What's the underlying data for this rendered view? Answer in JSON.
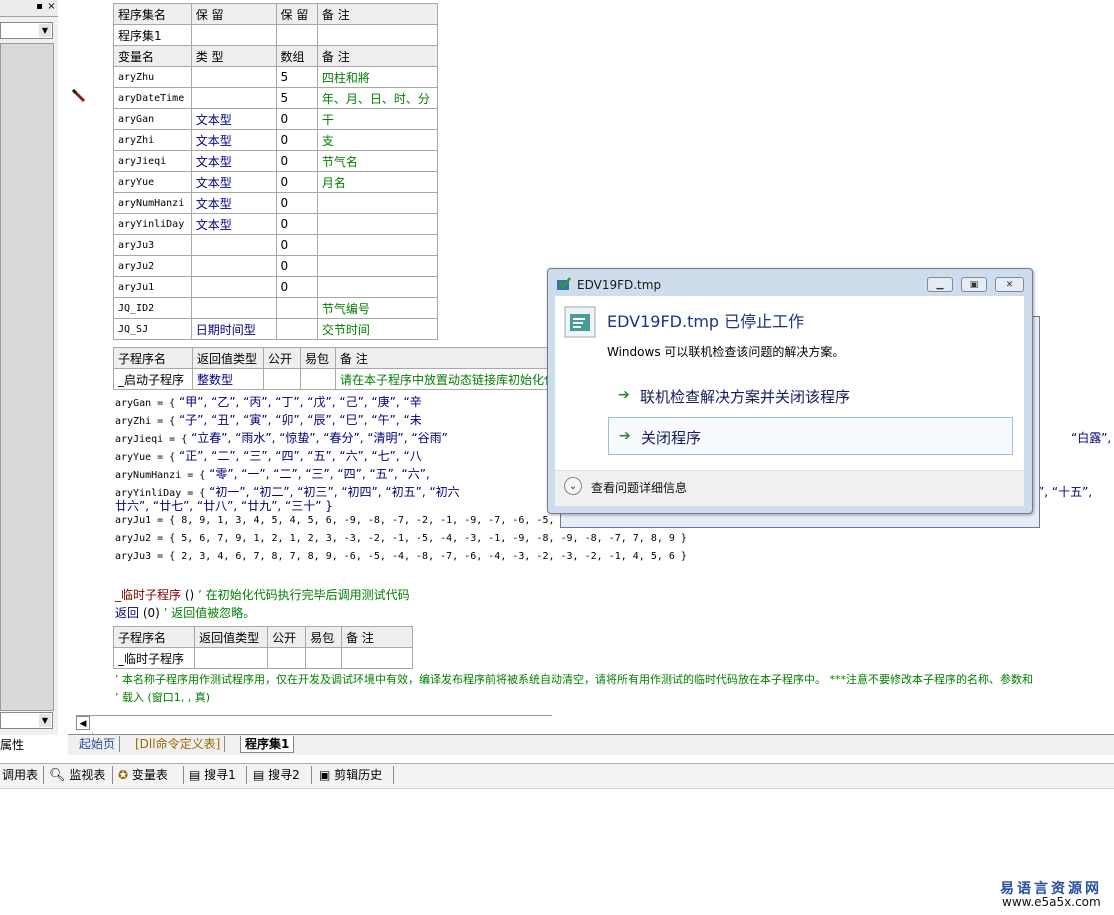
{
  "left_panel": {
    "minimize_glyph": "▪",
    "close_glyph": "×",
    "props_tab": "属性"
  },
  "table1": {
    "header": [
      "程序集名",
      "保 留",
      "保 留",
      "备 注"
    ],
    "row": [
      "程序集1",
      "",
      "",
      ""
    ]
  },
  "table2": {
    "header": [
      "变量名",
      "类 型",
      "数组",
      "备 注"
    ],
    "rows": [
      [
        "aryZhu",
        "",
        "5",
        "四柱和將"
      ],
      [
        "aryDateTime",
        "",
        "5",
        "年、月、日、时、分"
      ],
      [
        "aryGan",
        "文本型",
        "0",
        "干"
      ],
      [
        "aryZhi",
        "文本型",
        "0",
        "支"
      ],
      [
        "aryJieqi",
        "文本型",
        "0",
        "节气名"
      ],
      [
        "aryYue",
        "文本型",
        "0",
        "月名"
      ],
      [
        "aryNumHanzi",
        "文本型",
        "0",
        ""
      ],
      [
        "aryYinliDay",
        "文本型",
        "0",
        ""
      ],
      [
        "aryJu3",
        "",
        "0",
        ""
      ],
      [
        "aryJu2",
        "",
        "0",
        ""
      ],
      [
        "aryJu1",
        "",
        "0",
        ""
      ],
      [
        "JQ_ID2",
        "",
        "",
        "节气编号"
      ],
      [
        "JQ_SJ",
        "日期时间型",
        "",
        "交节时间"
      ]
    ]
  },
  "table3": {
    "header": [
      "子程序名",
      "返回值类型",
      "公开",
      "易包",
      "备 注"
    ],
    "row": [
      "_启动子程序",
      "整数型",
      "",
      "",
      "请在本子程序中放置动态链接库初始化代码"
    ]
  },
  "code": {
    "gan": {
      "lhs": "aryGan = {",
      "vals": "“甲”, “乙”, “丙”, “丁”, “戊”, “己”, “庚”, “辛"
    },
    "zhi": {
      "lhs": "aryZhi = {",
      "vals": "“子”, “丑”, “寅”, “卯”, “辰”, “巳”, “午”, “未"
    },
    "jieqi": {
      "lhs": "aryJieqi = {",
      "vals": "“立春”, “雨水”, “惊蛰”, “春分”, “清明”, “谷雨”",
      "tail": "“白露”, “秋"
    },
    "yue": {
      "lhs": "aryYue = {",
      "vals": "“正”, “二”, “三”, “四”, “五”, “六”, “七”, “八"
    },
    "numhanzi": {
      "lhs": "aryNumHanzi = {",
      "vals": "“零”, “一”, “二”, “三”, “四”, “五”, “六”,"
    },
    "yinliday": {
      "lhs": "aryYinliDay = {",
      "vals": "“初一”, “初二”, “初三”, “初四”, “初五”, “初六",
      "tail": "”, “十五”,",
      "cont": "廿六”, “廿七”, “廿八”, “廿九”, “三十” }"
    },
    "ju1": "aryJu1 = { 8, 9, 1, 3, 4, 5, 4, 5, 6, -9, -8, -7, -2, -1, -9, -7, -6, -5,",
    "ju2": "aryJu2 = { 5, 6, 7, 9, 1, 2, 1, 2, 3, -3, -2, -1, -5, -4, -3, -1, -9, -8, -9, -8, -7, 7, 8, 9 }",
    "ju3": "aryJu3 = { 2, 3, 4, 6, 7, 8, 7, 8, 9, -6, -5, -4, -8, -7, -6, -4, -3, -2, -3, -2, -1, 4, 5, 6 }",
    "temp_sub": {
      "name": "_临时子程序",
      "args": " () ",
      "comment": "’ 在初始化代码执行完毕后调用测试代码"
    },
    "ret": {
      "kw": "返回",
      "args": " (0) ",
      "comment": "’ 返回值被忽略。"
    },
    "note1": "’ 本名称子程序用作测试程序用，仅在开发及调试环境中有效，编译发布程序前将被系统自动清空，请将所有用作测试的临时代码放在本子程序中。 ***注意不要修改本子程序的名称、参数和",
    "note2": "’ 载入 (窗口1, , 真)"
  },
  "table4": {
    "header": [
      "子程序名",
      "返回值类型",
      "公开",
      "易包",
      "备 注"
    ],
    "row": [
      "_临时子程序",
      "",
      "",
      "",
      ""
    ]
  },
  "tabs": [
    "起始页",
    "[Dll命令定义表]",
    "程序集1"
  ],
  "bottom_bar": [
    "调用表",
    "监视表",
    "变量表",
    "搜寻1",
    "搜寻2",
    "剪辑历史"
  ],
  "dialog": {
    "title": "EDV19FD.tmp",
    "heading": "EDV19FD.tmp 已停止工作",
    "subtext": "Windows 可以联机检查该问题的解决方案。",
    "option1": "联机检查解决方案并关闭该程序",
    "option2": "关闭程序",
    "details": "查看问题详细信息"
  },
  "watermark": {
    "line1": "易语言资源网",
    "line2": "www.e5a5x.com"
  },
  "colors": {
    "keyword_blue": "#00007f",
    "comment_green": "#007f00",
    "dialog_heading": "#1e3287"
  }
}
